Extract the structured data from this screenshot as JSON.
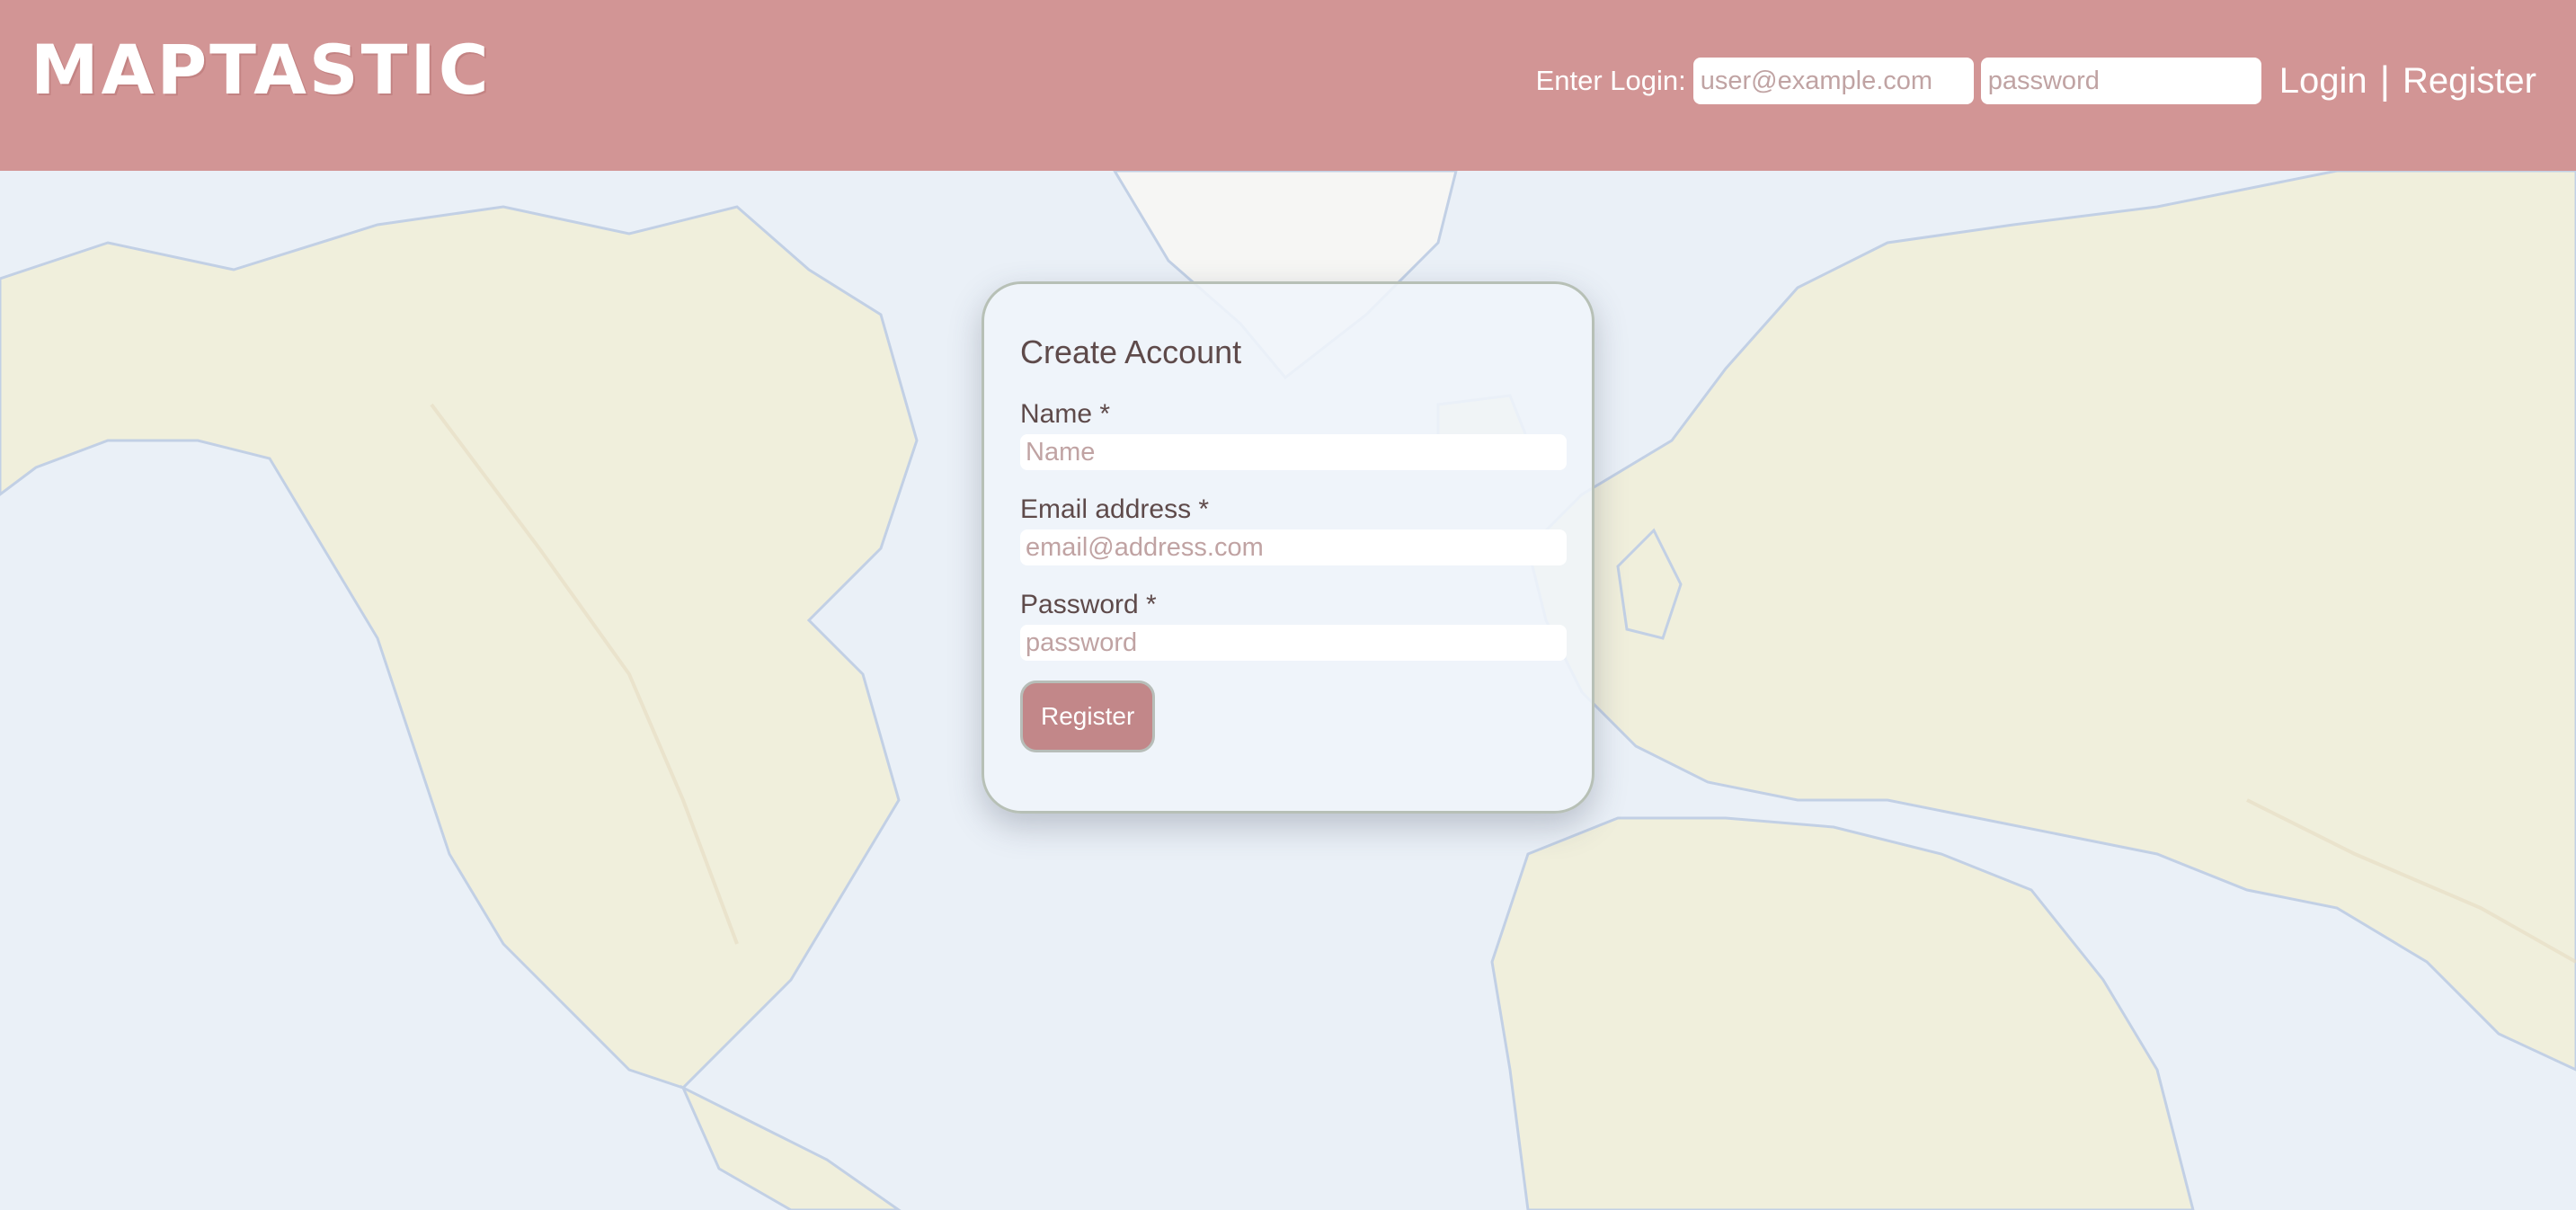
{
  "header": {
    "logo": "MAPTASTIC",
    "login_label": "Enter Login:",
    "email_placeholder": "user@example.com",
    "password_placeholder": "password",
    "login_link": "Login",
    "separator": "|",
    "register_link": "Register"
  },
  "form": {
    "title": "Create Account",
    "name_label": "Name *",
    "name_placeholder": "Name",
    "email_label": "Email address *",
    "email_placeholder": "email@address.com",
    "password_label": "Password *",
    "password_placeholder": "password",
    "submit_label": "Register"
  },
  "colors": {
    "header_bg": "#d29595",
    "button_bg": "#c28789",
    "ocean": "#dfe9f3",
    "land": "#e9e6c8"
  }
}
